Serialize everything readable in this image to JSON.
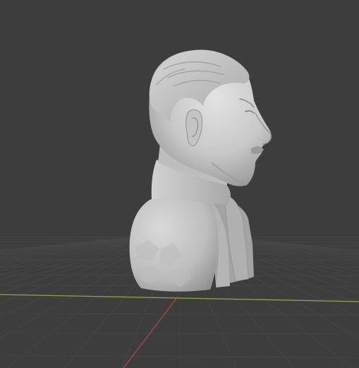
{
  "viewport": {
    "background_color": "#3d3d3d",
    "grid_line_color": "#474747",
    "x_axis_color": "#8aa94a",
    "y_axis_color": "#b8464f",
    "object": {
      "kind": "sculpted bust",
      "color": "#c9c9c9",
      "shade_color": "#9b9b9b",
      "highlight_color": "#e1e1e1"
    }
  }
}
